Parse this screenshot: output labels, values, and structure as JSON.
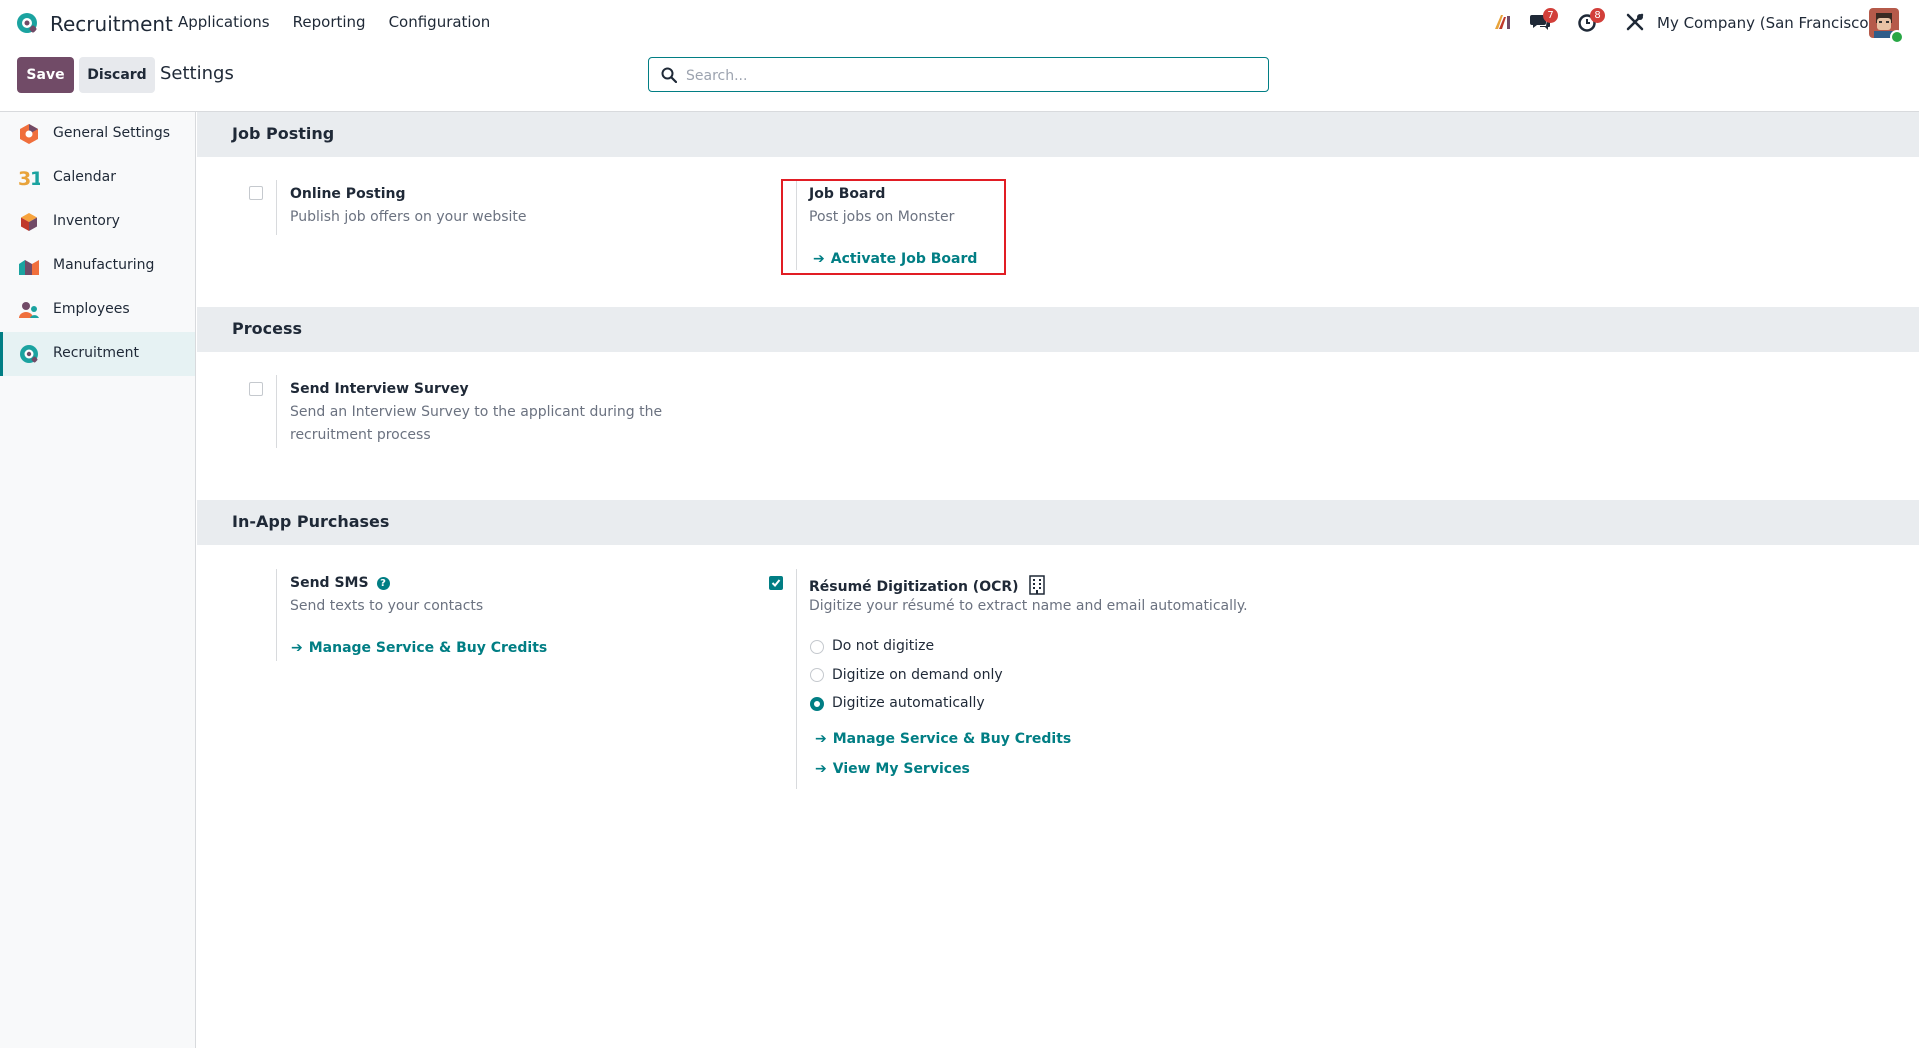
{
  "navbar": {
    "app_title": "Recruitment",
    "menu": [
      "Applications",
      "Reporting",
      "Configuration"
    ],
    "messages_badge": "7",
    "activities_badge": "8",
    "company": "My Company (San Francisco)",
    "icons": [
      "spreadsheet-icon",
      "chat-icon",
      "clock-icon",
      "tools-icon",
      "avatar"
    ]
  },
  "control_panel": {
    "save_label": "Save",
    "discard_label": "Discard",
    "title": "Settings",
    "search_placeholder": "Search..."
  },
  "sidebar": {
    "items": [
      {
        "label": "General Settings",
        "icon": "general-settings-icon"
      },
      {
        "label": "Calendar",
        "icon": "calendar-icon"
      },
      {
        "label": "Inventory",
        "icon": "inventory-icon"
      },
      {
        "label": "Manufacturing",
        "icon": "manufacturing-icon"
      },
      {
        "label": "Employees",
        "icon": "employees-icon"
      },
      {
        "label": "Recruitment",
        "icon": "recruitment-icon",
        "active": true
      }
    ]
  },
  "sections": {
    "job_posting": {
      "title": "Job Posting",
      "online_posting": {
        "title": "Online Posting",
        "desc": "Publish job offers on your website",
        "checked": false
      },
      "job_board": {
        "title": "Job Board",
        "desc": "Post jobs on Monster",
        "link": "Activate Job Board"
      }
    },
    "process": {
      "title": "Process",
      "interview_survey": {
        "title": "Send Interview Survey",
        "desc": "Send an Interview Survey to the applicant during the recruitment process",
        "checked": false
      }
    },
    "in_app": {
      "title": "In-App Purchases",
      "sms": {
        "title": "Send SMS",
        "desc": "Send texts to your contacts",
        "link": "Manage Service & Buy Credits"
      },
      "ocr": {
        "title": "Résumé Digitization (OCR)",
        "desc": "Digitize your résumé to extract name and email automatically.",
        "checked": true,
        "options": [
          "Do not digitize",
          "Digitize on demand only",
          "Digitize automatically"
        ],
        "selected": "Digitize automatically",
        "link_manage": "Manage Service & Buy Credits",
        "link_view": "View My Services"
      }
    }
  },
  "colors": {
    "primary": "#714b67",
    "accent": "#017e84",
    "highlight": "#e11d24"
  }
}
